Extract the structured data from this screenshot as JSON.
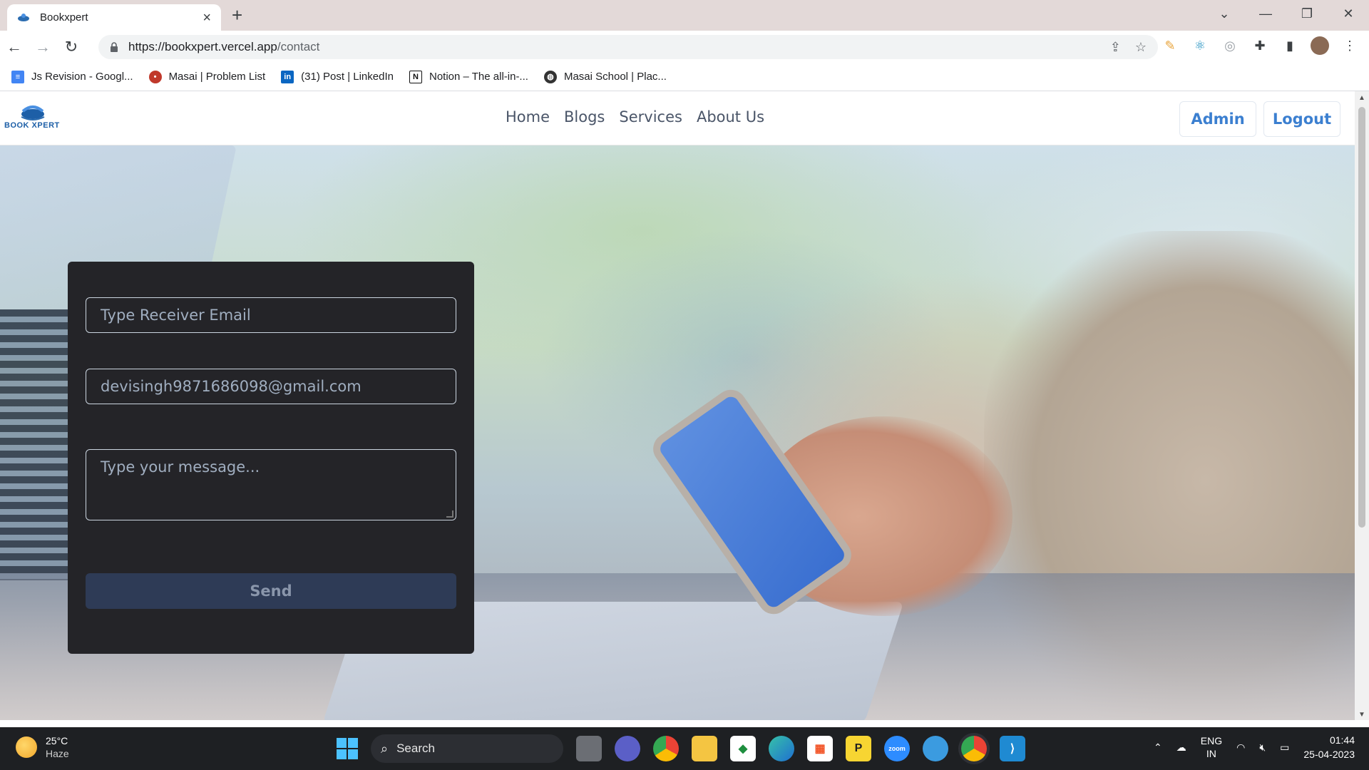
{
  "browser": {
    "tab_title": "Bookxpert",
    "url_host": "https://bookxpert.vercel.app",
    "url_path": "/contact",
    "bookmarks": [
      {
        "label": "Js Revision - Googl...",
        "icon": "google-docs-icon",
        "color": "#4285f4"
      },
      {
        "label": "Masai | Problem List",
        "icon": "masai-icon",
        "color": "#c0392b"
      },
      {
        "label": "(31) Post | LinkedIn",
        "icon": "linkedin-icon",
        "color": "#0a66c2"
      },
      {
        "label": "Notion – The all-in-...",
        "icon": "notion-icon",
        "color": "#111111"
      },
      {
        "label": "Masai School | Plac...",
        "icon": "globe-icon",
        "color": "#333333"
      }
    ]
  },
  "site": {
    "logo_text": "BOOK XPERT",
    "nav": [
      "Home",
      "Blogs",
      "Services",
      "About Us"
    ],
    "admin_label": "Admin",
    "logout_label": "Logout",
    "accent": "#3b7fd0"
  },
  "form": {
    "receiver_placeholder": "Type Receiver Email",
    "sender_value": "devisingh9871686098@gmail.com",
    "message_placeholder": "Type your message...",
    "send_label": "Send"
  },
  "taskbar": {
    "temperature": "25°C",
    "weather": "Haze",
    "search_label": "Search",
    "lang_top": "ENG",
    "lang_bottom": "IN",
    "time": "01:44",
    "date": "25-04-2023"
  }
}
